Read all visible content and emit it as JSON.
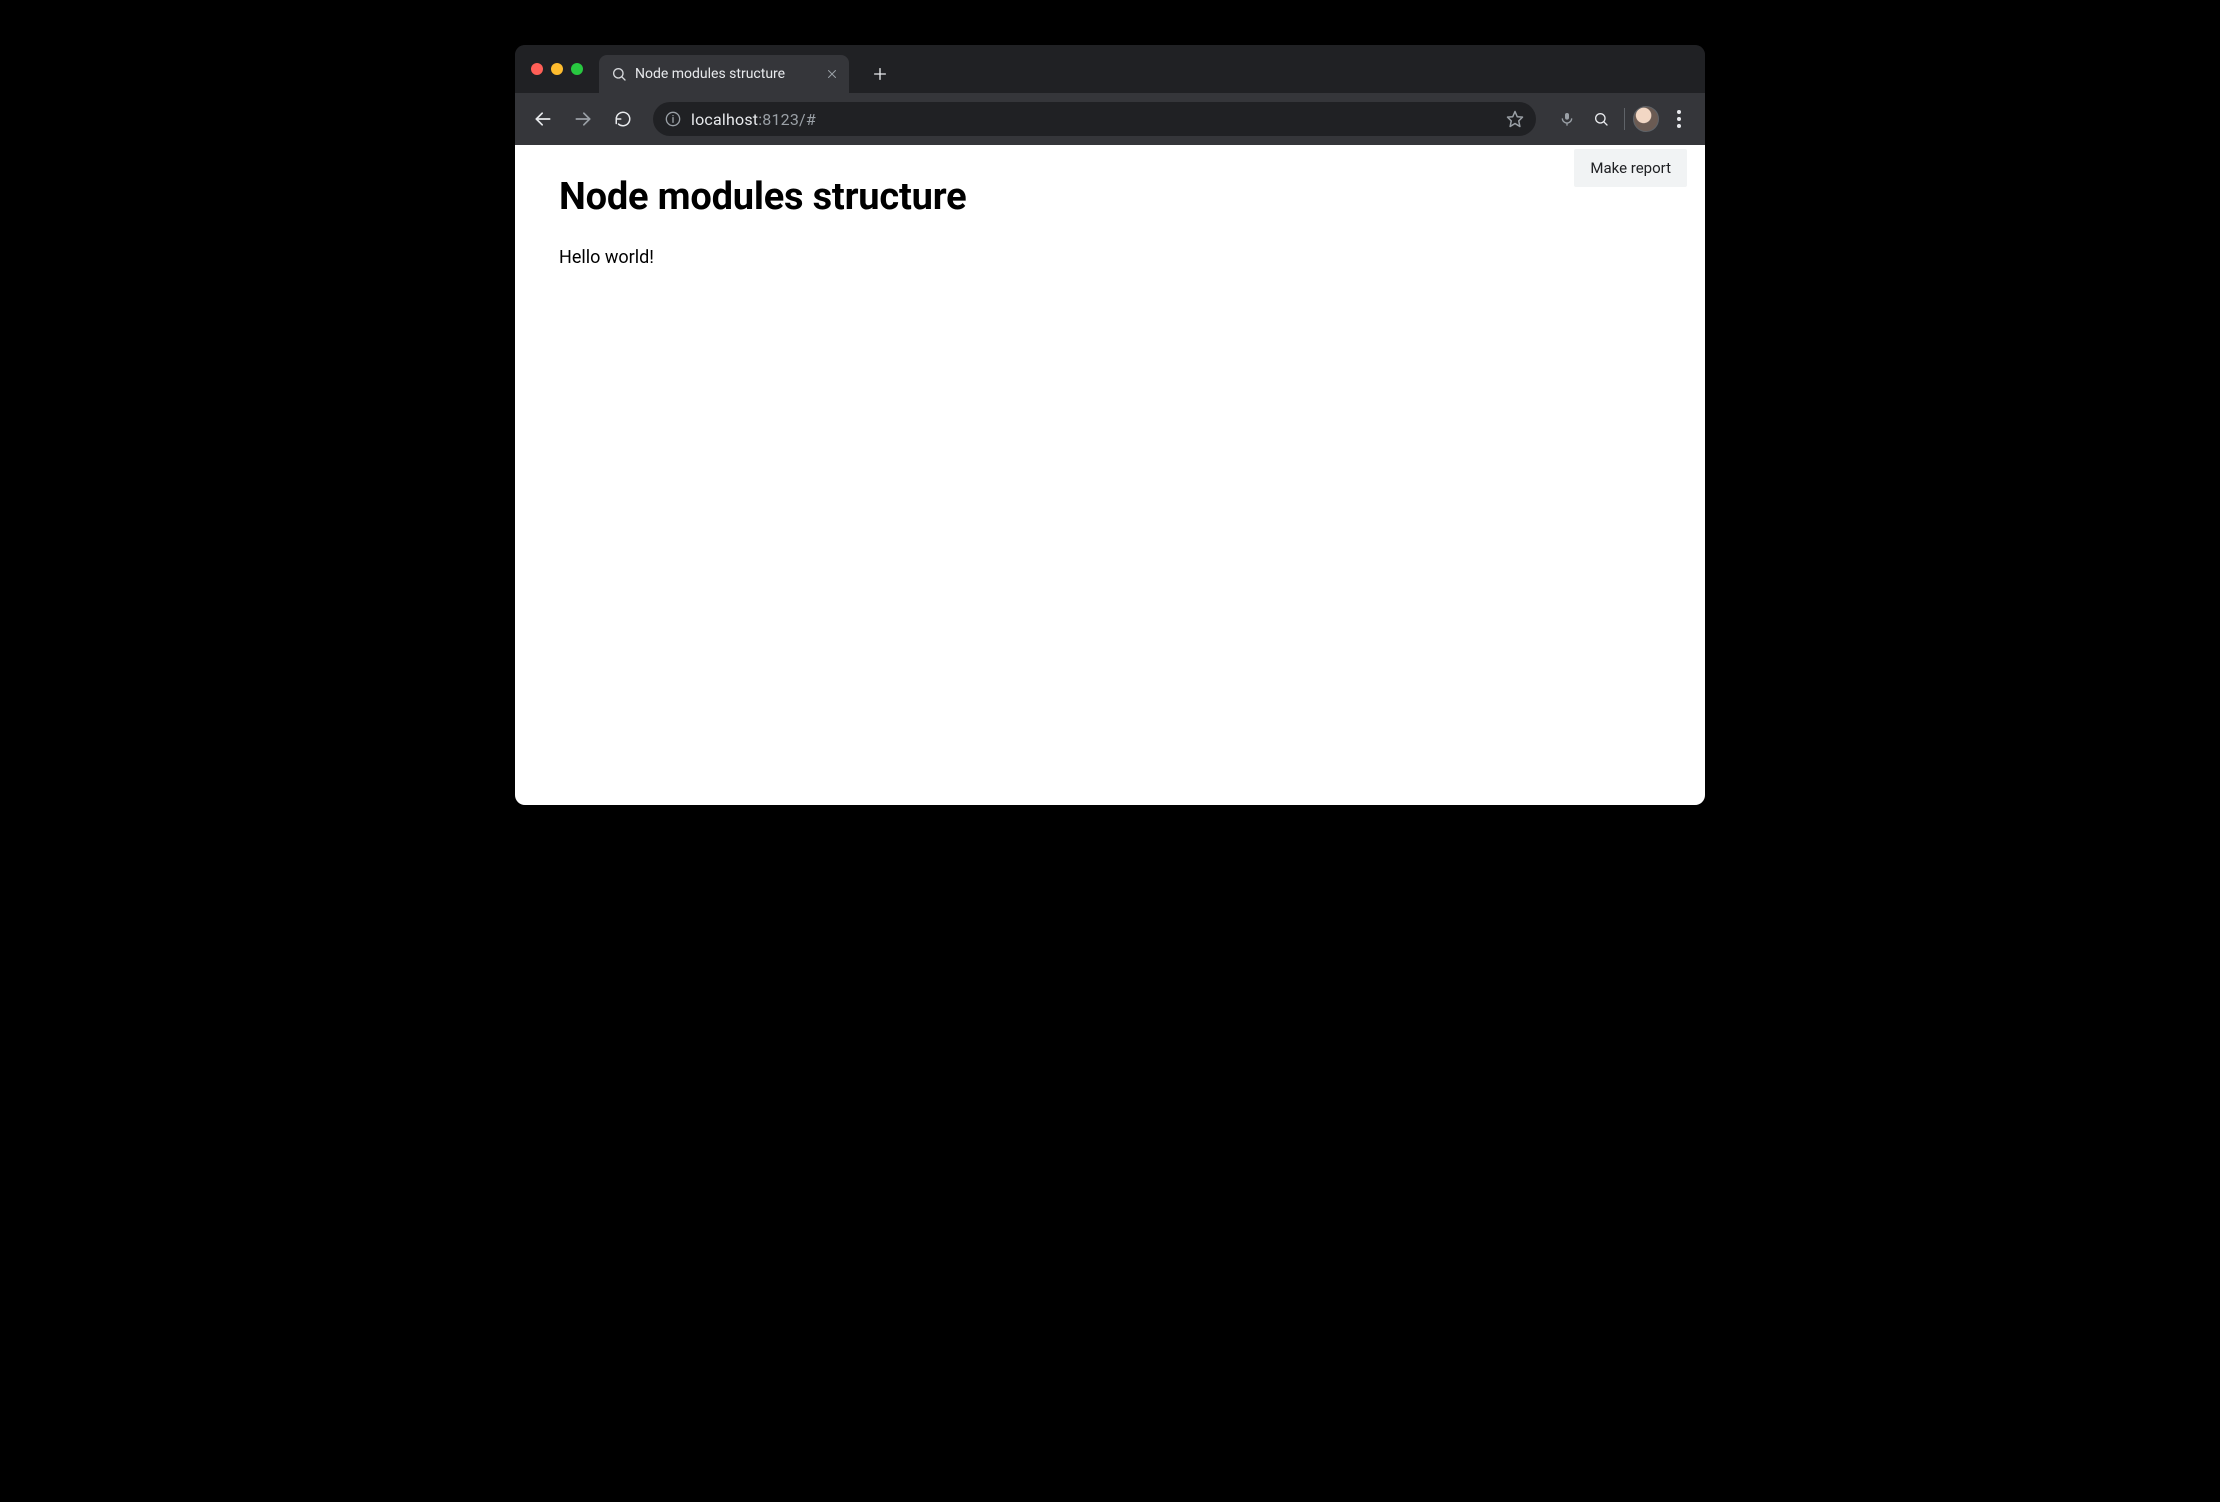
{
  "tab": {
    "title": "Node modules structure"
  },
  "url": {
    "host": "localhost",
    "rest": ":8123/#"
  },
  "page": {
    "heading": "Node modules structure",
    "body": "Hello world!",
    "report_button": "Make report"
  }
}
